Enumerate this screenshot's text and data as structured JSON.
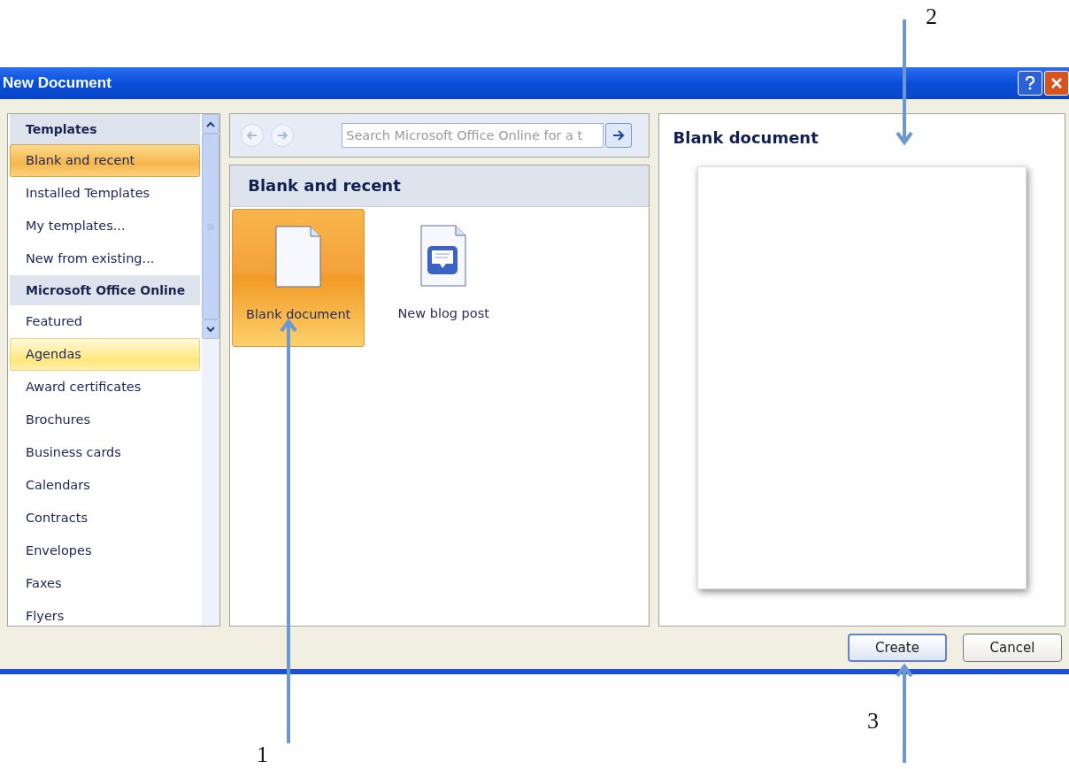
{
  "window": {
    "title": "New Document"
  },
  "sidebar": {
    "items": [
      {
        "kind": "heading",
        "label": "Templates"
      },
      {
        "kind": "item",
        "label": "Blank and recent",
        "selected": true,
        "hovered": false
      },
      {
        "kind": "item",
        "label": "Installed Templates",
        "selected": false,
        "hovered": false
      },
      {
        "kind": "item",
        "label": "My templates...",
        "selected": false,
        "hovered": false
      },
      {
        "kind": "item",
        "label": "New from existing...",
        "selected": false,
        "hovered": false
      },
      {
        "kind": "heading",
        "label": "Microsoft Office Online"
      },
      {
        "kind": "item",
        "label": "Featured",
        "selected": false,
        "hovered": false
      },
      {
        "kind": "item",
        "label": "Agendas",
        "selected": false,
        "hovered": true
      },
      {
        "kind": "item",
        "label": "Award certificates",
        "selected": false,
        "hovered": false
      },
      {
        "kind": "item",
        "label": "Brochures",
        "selected": false,
        "hovered": false
      },
      {
        "kind": "item",
        "label": "Business cards",
        "selected": false,
        "hovered": false
      },
      {
        "kind": "item",
        "label": "Calendars",
        "selected": false,
        "hovered": false
      },
      {
        "kind": "item",
        "label": "Contracts",
        "selected": false,
        "hovered": false
      },
      {
        "kind": "item",
        "label": "Envelopes",
        "selected": false,
        "hovered": false
      },
      {
        "kind": "item",
        "label": "Faxes",
        "selected": false,
        "hovered": false
      },
      {
        "kind": "item",
        "label": "Flyers",
        "selected": false,
        "hovered": false
      }
    ]
  },
  "search": {
    "placeholder": "Search Microsoft Office Online for a t"
  },
  "gallery": {
    "title": "Blank and recent",
    "items": [
      {
        "kind": "blank",
        "label": "Blank document",
        "selected": true
      },
      {
        "kind": "blog",
        "label": "New blog post",
        "selected": false
      }
    ]
  },
  "preview": {
    "title": "Blank document"
  },
  "buttons": [
    {
      "label": "Create",
      "default": true
    },
    {
      "label": "Cancel",
      "default": false
    }
  ],
  "annotations": [
    {
      "label": "1"
    },
    {
      "label": "2"
    },
    {
      "label": "3"
    }
  ]
}
